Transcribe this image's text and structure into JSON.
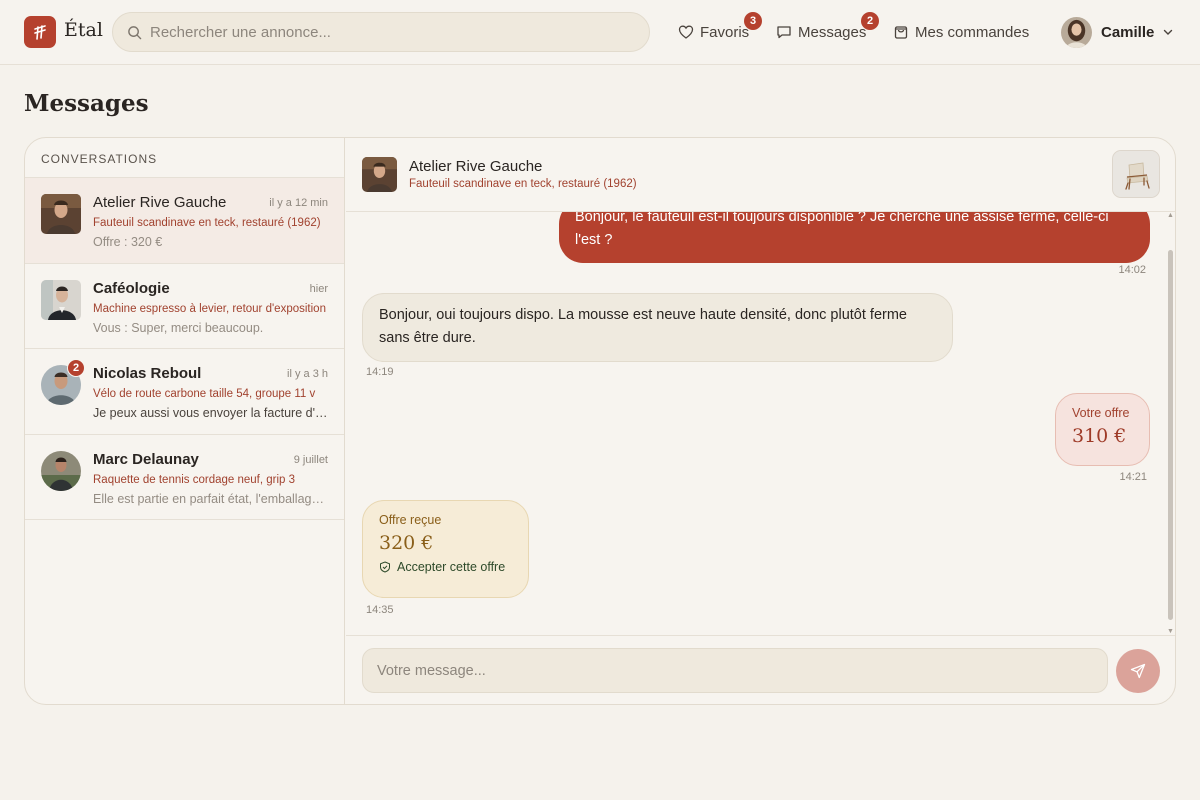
{
  "brand": {
    "name": "Étal"
  },
  "search": {
    "placeholder": "Rechercher une annonce..."
  },
  "nav": {
    "favorites": {
      "label": "Favoris",
      "badge": "3"
    },
    "messages": {
      "label": "Messages",
      "badge": "2"
    },
    "orders": {
      "label": "Mes commandes"
    }
  },
  "user": {
    "name": "Camille"
  },
  "page": {
    "title": "Messages"
  },
  "conversations": {
    "header": "CONVERSATIONS",
    "items": [
      {
        "name": "Atelier Rive Gauche",
        "time": "il y a 12 min",
        "item": "Fauteuil scandinave en teck, restauré (1962)",
        "preview": "Offre : 320 €"
      },
      {
        "name": "Caféologie",
        "time": "hier",
        "item": "Machine espresso à levier, retour d'exposition",
        "preview": "Vous : Super, merci beaucoup."
      },
      {
        "name": "Nicolas Reboul",
        "time": "il y a 3 h",
        "item": "Vélo de route carbone taille 54, groupe 11 v",
        "preview": "Je peux aussi vous envoyer la facture d'achat",
        "badge": "2"
      },
      {
        "name": "Marc Delaunay",
        "time": "9 juillet",
        "item": "Raquette de tennis cordage neuf, grip 3",
        "preview": "Elle est partie en parfait état, l'emballage était soigné"
      }
    ]
  },
  "chat": {
    "name": "Atelier Rive Gauche",
    "item": "Fauteuil scandinave en teck, restauré (1962)",
    "messages": {
      "m1": {
        "text": "Bonjour, le fauteuil est-il toujours disponible ? Je cherche une assise ferme, celle-ci l'est ?",
        "time": "14:02"
      },
      "m2": {
        "text": "Bonjour, oui toujours dispo. La mousse est neuve haute densité, donc plutôt ferme sans être dure.",
        "time": "14:19"
      },
      "offer_sent": {
        "label": "Votre offre",
        "amount": "310 €",
        "time": "14:21"
      },
      "offer_received": {
        "label": "Offre reçue",
        "amount": "320 €",
        "action": "Accepter cette offre",
        "time": "14:35"
      }
    },
    "composer": {
      "placeholder": "Votre message..."
    }
  },
  "colors": {
    "accent": "#b5412e",
    "background": "#f5f2ec",
    "offer_received_bg": "#f6ecd7"
  }
}
